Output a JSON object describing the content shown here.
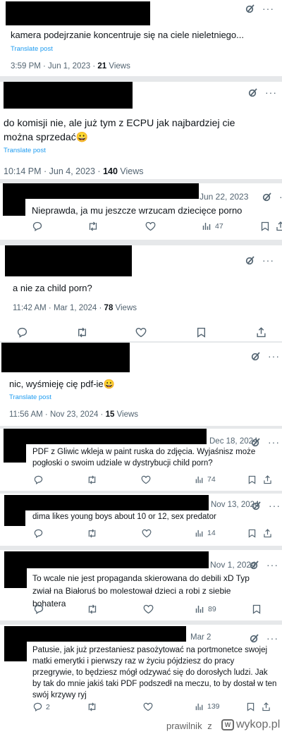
{
  "posts": [
    {
      "date": "",
      "text": "kamera podejrzanie koncentruje się na ciele nieletniego...",
      "translate": "Translate post",
      "time": "3:59 PM · Jun 1, 2023 · ",
      "views": "21",
      "views_label": " Views"
    },
    {
      "date": "",
      "text": "do komisji nie, ale już tym z  ECPU jak najbardziej cie można sprzedać😀",
      "translate": "Translate post",
      "time": "10:14 PM · Jun 4, 2023 · ",
      "views": "140",
      "views_label": " Views"
    },
    {
      "date": "Jun 22, 2023",
      "text": "Nieprawda, ja mu jeszcze wrzucam dziecięce porno",
      "views_count": "47"
    },
    {
      "text": "a nie za child porn?",
      "time": "11:42 AM · Mar 1, 2024 · ",
      "views": "78",
      "views_label": " Views"
    },
    {
      "text": "nic, wyśmieję cię pdf-ie😀",
      "translate": "Translate post",
      "time": "11:56 AM · Nov 23, 2024 · ",
      "views": "15",
      "views_label": " Views"
    },
    {
      "date": "Dec 18, 2024",
      "text": "PDF z Gliwic wkleja w paint ruska do zdjęcia. Wyjaśnisz może pogłoski o swoim udziale w dystrybucji child porn?",
      "views_count": "74"
    },
    {
      "date": "Nov 13, 2024",
      "text": "dima likes young boys about 10 or 12, sex predator",
      "views_count": "14"
    },
    {
      "date": "Nov 1, 2024",
      "text": "To wcale nie jest propaganda skierowana do debili xD Typ zwiał na Białoruś bo molestował dzieci a robi z siebie bohatera",
      "views_count": "89"
    },
    {
      "date": "Mar 2",
      "text": "Patusie, jak już przestaniesz pasożytować na portmonetce swojej matki emerytki i pierwszy raz w życiu pójdziesz do pracy przegrywie, to będziesz mógł odzywać się do dorosłych ludzi.  Jak by tak do mnie jakiś taki PDF podszedł  na meczu, to by dostał w ten swój krzywy ryj",
      "reply_count": "2",
      "views_count": "139"
    }
  ],
  "footer": {
    "username": "prawilnik",
    "separator": "z",
    "site": "wykop.pl",
    "logo_letter": "W"
  },
  "colors": {
    "accent": "#1d9bf0",
    "muted": "#536471",
    "separator": "#e6e8ea"
  }
}
